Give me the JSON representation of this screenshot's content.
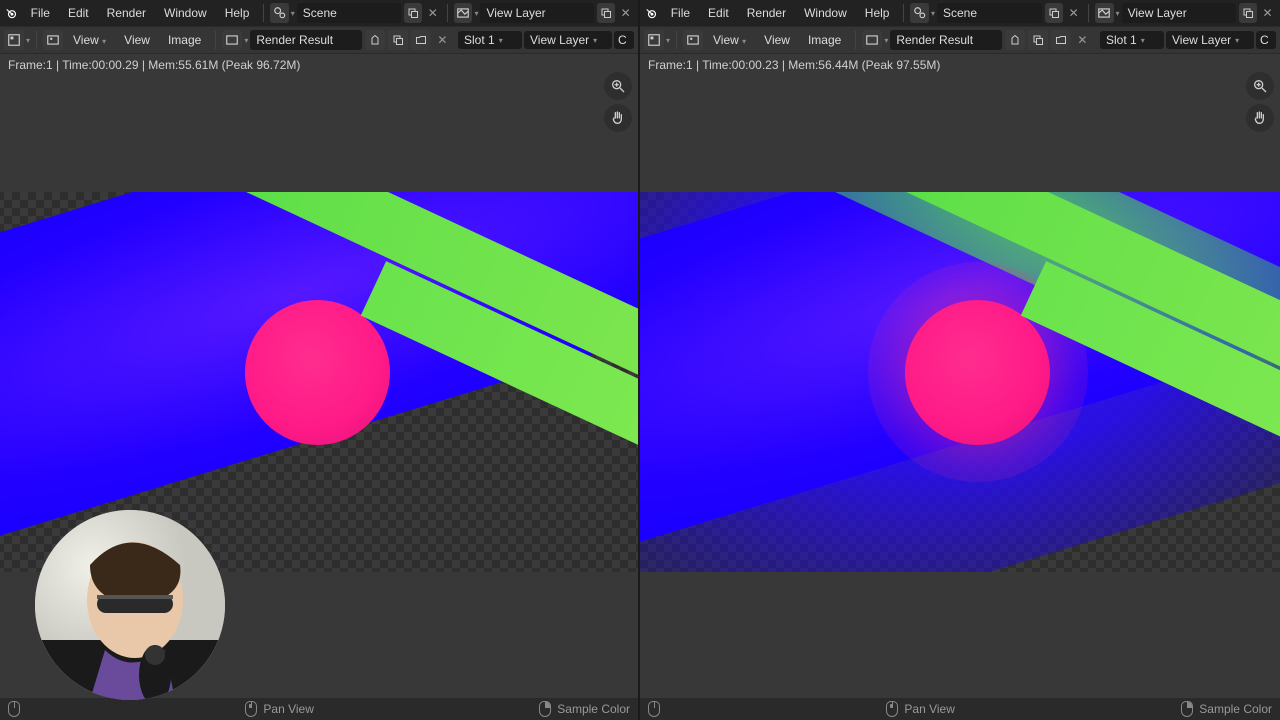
{
  "colors": {
    "accent": "#5680C2",
    "bg": "#383838",
    "header": "#222"
  },
  "topmenu": {
    "file": "File",
    "edit": "Edit",
    "render": "Render",
    "window": "Window",
    "help": "Help"
  },
  "scene": {
    "label": "Scene"
  },
  "viewlayer": {
    "label": "View Layer"
  },
  "toolbar": {
    "view": "View",
    "view2": "View",
    "image": "Image",
    "render_result": "Render Result",
    "slot": "Slot 1",
    "view_layer": "View Layer",
    "c": "C"
  },
  "left": {
    "status": "Frame:1 | Time:00:00.29 | Mem:55.61M (Peak 96.72M)"
  },
  "right": {
    "status": "Frame:1 | Time:00:00.23 | Mem:56.44M (Peak 97.55M)"
  },
  "footer": {
    "pan": "Pan View",
    "sample": "Sample Color"
  }
}
